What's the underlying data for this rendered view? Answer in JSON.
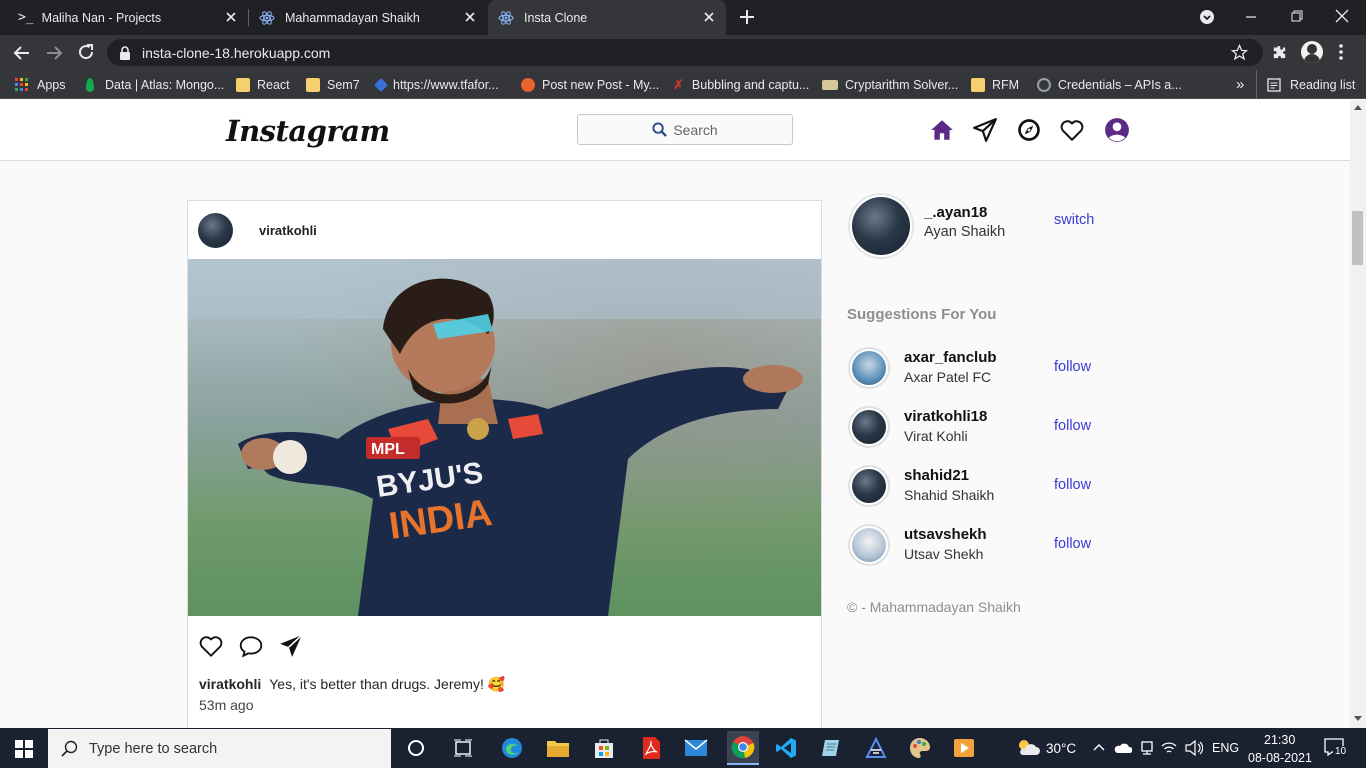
{
  "browser": {
    "tabs": [
      {
        "label": "Maliha Nan - Projects",
        "active": false
      },
      {
        "label": "Mahammadayan Shaikh",
        "active": false
      },
      {
        "label": "Insta Clone",
        "active": true
      }
    ],
    "url": "insta-clone-18.herokuapp.com",
    "bookmarks": [
      "Apps",
      "Data | Atlas: Mongo...",
      "React",
      "Sem7",
      "https://www.tfafor...",
      "Post new Post - My...",
      "Bubbling and captu...",
      "Cryptarithm Solver...",
      "RFM",
      "Credentials – APIs a..."
    ],
    "more_bookmarks": "»",
    "reading_list": "Reading list"
  },
  "nav": {
    "logo": "Instagram",
    "search_placeholder": "Search",
    "icons": [
      "home-icon",
      "direct-icon",
      "explore-icon",
      "activity-icon",
      "profile-icon"
    ],
    "accent": "#5b2a86"
  },
  "post": {
    "username": "viratkohli",
    "caption_user": "viratkohli",
    "caption": "Yes, it's better than drugs. Jeremy! 🥰",
    "time": "53m ago"
  },
  "sidebar": {
    "me": {
      "username": "_.ayan18",
      "fullname": "Ayan Shaikh",
      "action": "switch"
    },
    "suggestions_title": "Suggestions For You",
    "suggestions": [
      {
        "username": "axar_fanclub",
        "fullname": "Axar Patel FC",
        "action": "follow"
      },
      {
        "username": "viratkohli18",
        "fullname": "Virat Kohli",
        "action": "follow"
      },
      {
        "username": "shahid21",
        "fullname": "Shahid Shaikh",
        "action": "follow"
      },
      {
        "username": "utsavshekh",
        "fullname": "Utsav Shekh",
        "action": "follow"
      }
    ],
    "copyright": "© - Mahammadayan Shaikh",
    "link_color": "#3a3ad6"
  },
  "taskbar": {
    "search_placeholder": "Type here to search",
    "weather": "30°C",
    "language": "ENG",
    "time": "21:30",
    "date": "08-08-2021",
    "notifications": "10"
  }
}
